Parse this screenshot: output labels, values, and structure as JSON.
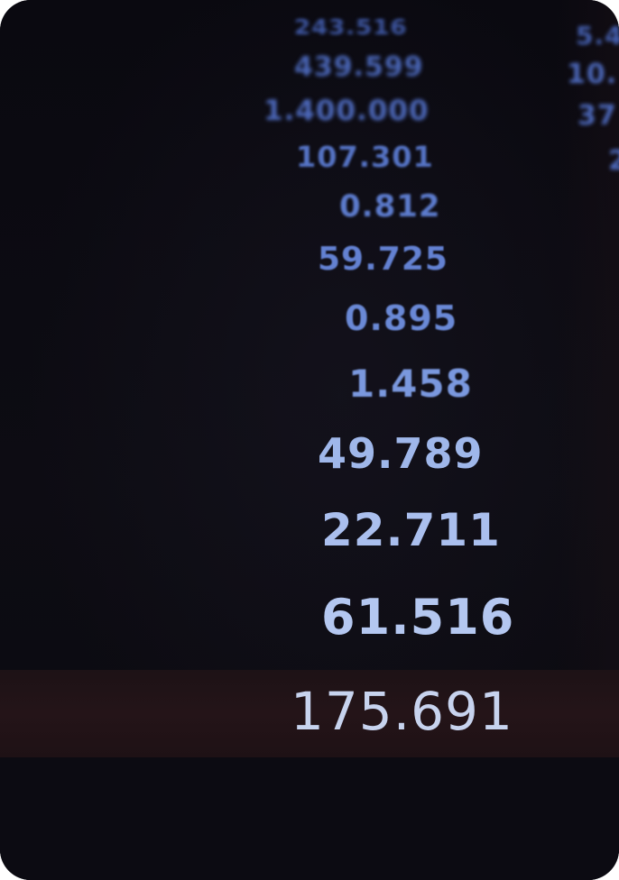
{
  "main_column": [
    "243.516",
    "439.599",
    "1.400.000",
    "107.301",
    "0.812",
    "59.725",
    "0.895",
    "1.458",
    "49.789",
    "22.711",
    "61.516",
    "175.691"
  ],
  "right_column_partial": [
    "5.4",
    "10.",
    "37",
    "2"
  ],
  "colors": {
    "background": "#0b0a10",
    "digit_blue": "#6f8fd6",
    "digit_light": "#b9ccf0",
    "highlight_row": "#241418"
  }
}
